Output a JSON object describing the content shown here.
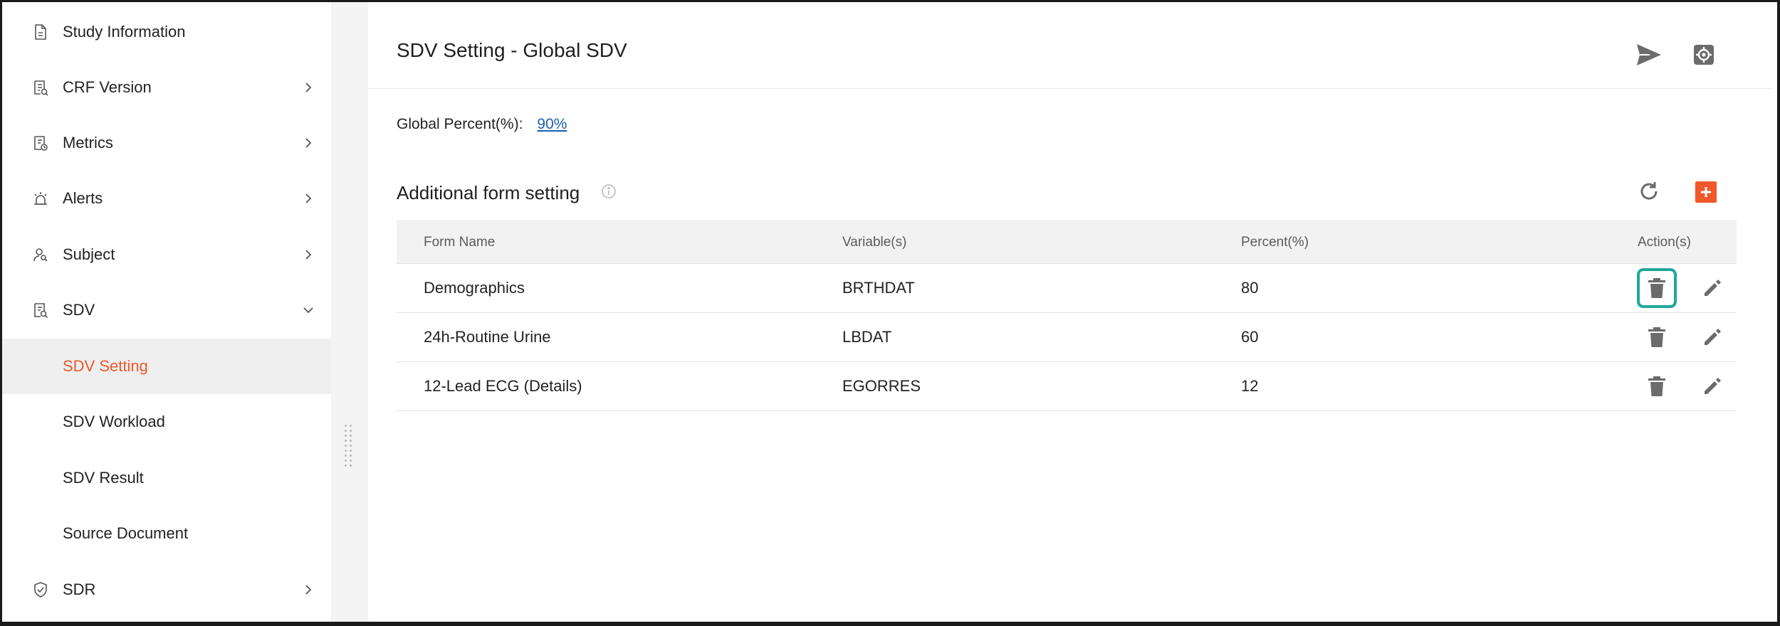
{
  "sidebar": {
    "items": [
      {
        "label": "Study Information",
        "icon": "document-icon"
      },
      {
        "label": "CRF Version",
        "icon": "crf-version-icon"
      },
      {
        "label": "Metrics",
        "icon": "metrics-icon"
      },
      {
        "label": "Alerts",
        "icon": "alarm-icon"
      },
      {
        "label": "Subject",
        "icon": "subject-icon"
      },
      {
        "label": "SDV",
        "icon": "sdv-icon"
      },
      {
        "label": "SDV Setting"
      },
      {
        "label": "SDV Workload"
      },
      {
        "label": "SDV Result"
      },
      {
        "label": "Source Document"
      },
      {
        "label": "SDR",
        "icon": "shield-check-icon"
      }
    ]
  },
  "header": {
    "title": "SDV Setting - Global SDV"
  },
  "global": {
    "label": "Global Percent(%):",
    "value": "90%"
  },
  "section": {
    "title": "Additional form setting"
  },
  "table": {
    "columns": [
      "Form Name",
      "Variable(s)",
      "Percent(%)",
      "Action(s)"
    ],
    "rows": [
      {
        "form": "Demographics",
        "variables": "BRTHDAT",
        "percent": "80"
      },
      {
        "form": "24h-Routine Urine",
        "variables": "LBDAT",
        "percent": "60"
      },
      {
        "form": "12-Lead ECG (Details)",
        "variables": "EGORRES",
        "percent": "12"
      }
    ]
  },
  "colors": {
    "accent": "#f0582a",
    "highlight": "#1fa99a",
    "link": "#1a5fb4"
  }
}
